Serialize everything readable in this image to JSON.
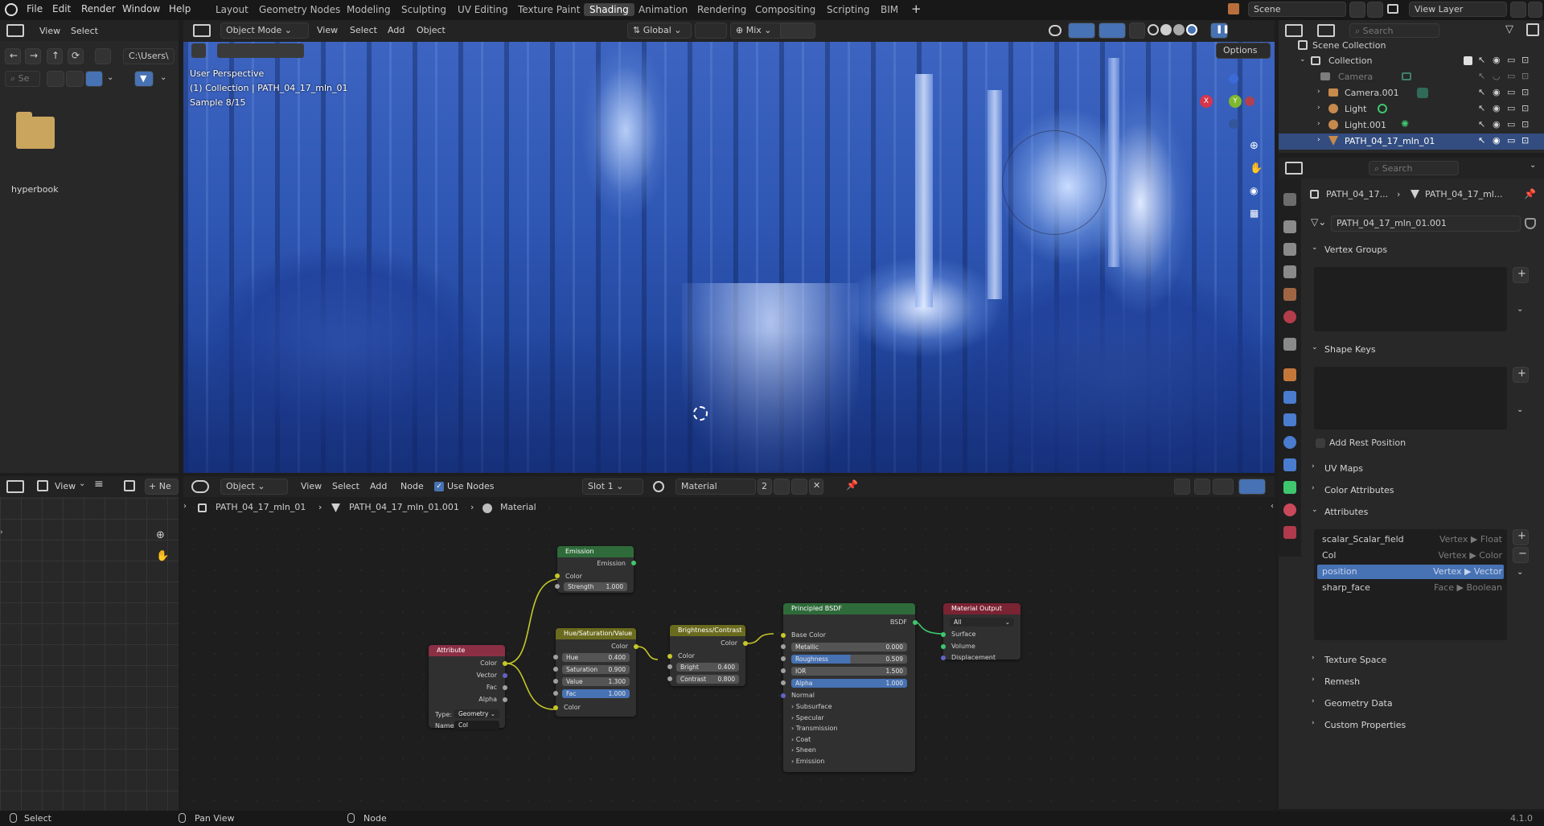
{
  "topbar": {
    "menus": [
      "File",
      "Edit",
      "Render",
      "Window",
      "Help"
    ],
    "workspaces": [
      "Layout",
      "Geometry Nodes",
      "Modeling",
      "Sculpting",
      "UV Editing",
      "Texture Paint",
      "Shading",
      "Animation",
      "Rendering",
      "Compositing",
      "Scripting",
      "BIM"
    ],
    "active_workspace": "Shading",
    "add": "+",
    "scene": "Scene",
    "view_layer": "View Layer"
  },
  "filebrowser": {
    "menus": [
      "View",
      "Select"
    ],
    "path": "C:\\Users\\",
    "search_placeholder": "Se",
    "folder": "hyperbook"
  },
  "viewport": {
    "mode": "Object Mode",
    "menus": [
      "View",
      "Select",
      "Add",
      "Object"
    ],
    "transform": "Global",
    "snap": "Mix",
    "options": "Options",
    "overlay": [
      "User Perspective",
      "(1) Collection | PATH_04_17_mln_01",
      "Sample 8/15"
    ],
    "gizmo": {
      "x": "X",
      "y": "Y",
      "z": "Z"
    }
  },
  "outliner": {
    "search_placeholder": "Search",
    "root": "Scene Collection",
    "items": [
      {
        "name": "Collection"
      },
      {
        "name": "Camera"
      },
      {
        "name": "Camera.001"
      },
      {
        "name": "Light"
      },
      {
        "name": "Light.001"
      },
      {
        "name": "PATH_04_17_mln_01"
      }
    ]
  },
  "properties": {
    "search_placeholder": "Search",
    "crumb1": "PATH_04_17...",
    "crumb2": "PATH_04_17_ml...",
    "mesh_name": "PATH_04_17_mln_01.001",
    "sections": {
      "vertex_groups": "Vertex Groups",
      "shape_keys": "Shape Keys",
      "add_rest": "Add Rest Position",
      "uv_maps": "UV Maps",
      "color_attributes": "Color Attributes",
      "attributes": "Attributes",
      "texture_space": "Texture Space",
      "remesh": "Remesh",
      "geometry_data": "Geometry Data",
      "custom_properties": "Custom Properties"
    },
    "attributes": [
      {
        "name": "scalar_Scalar_field",
        "domain": "Vertex ▶ Float"
      },
      {
        "name": "Col",
        "domain": "Vertex ▶ Color"
      },
      {
        "name": "position",
        "domain": "Vertex ▶ Vector"
      },
      {
        "name": "sharp_face",
        "domain": "Face ▶ Boolean"
      }
    ]
  },
  "left_bottom": {
    "view": "View",
    "new": "Ne"
  },
  "node_editor": {
    "object": "Object",
    "menus": [
      "View",
      "Select",
      "Add",
      "Node"
    ],
    "use_nodes": "Use Nodes",
    "slot": "Slot 1",
    "material": "Material",
    "users": "2",
    "breadcrumb": [
      "PATH_04_17_mln_01",
      "PATH_04_17_mln_01.001",
      "Material"
    ],
    "nodes": {
      "emission": {
        "title": "Emission",
        "out": "Emission",
        "in": "Color",
        "strength_label": "Strength",
        "strength": "1.000"
      },
      "hsv": {
        "title": "Hue/Saturation/Value",
        "out": "Color",
        "hue_l": "Hue",
        "hue": "0.400",
        "sat_l": "Saturation",
        "sat": "0.900",
        "val_l": "Value",
        "val": "1.300",
        "fac_l": "Fac",
        "fac": "1.000",
        "in": "Color"
      },
      "bc": {
        "title": "Brightness/Contrast",
        "out": "Color",
        "in": "Color",
        "bright_l": "Bright",
        "bright": "0.400",
        "contrast_l": "Contrast",
        "contrast": "0.800"
      },
      "bsdf": {
        "title": "Principled BSDF",
        "out": "BSDF",
        "base": "Base Color",
        "metallic_l": "Metallic",
        "metallic": "0.000",
        "rough_l": "Roughness",
        "rough": "0.509",
        "ior_l": "IOR",
        "ior": "1.500",
        "alpha_l": "Alpha",
        "alpha": "1.000",
        "normal": "Normal",
        "panels": [
          "Subsurface",
          "Specular",
          "Transmission",
          "Coat",
          "Sheen",
          "Emission"
        ]
      },
      "output": {
        "title": "Material Output",
        "target": "All",
        "surface": "Surface",
        "volume": "Volume",
        "displacement": "Displacement"
      },
      "attribute": {
        "title": "Attribute",
        "color": "Color",
        "vector": "Vector",
        "fac": "Fac",
        "alpha": "Alpha",
        "type_l": "Type:",
        "type": "Geometry",
        "name_l": "Name:",
        "name": "Col"
      }
    }
  },
  "statusbar": {
    "select": "Select",
    "pan": "Pan View",
    "node": "Node",
    "version": "4.1.0"
  },
  "colors": {
    "accent": "#4772b3",
    "attr_header": "#8b2f45",
    "emission_header": "#2f6b3a",
    "color_header": "#6b6b1f",
    "bsdf_header": "#2f6b3a",
    "output_header": "#7a2333",
    "socket_yellow": "#c7c729",
    "socket_purple": "#6363c7",
    "socket_gray": "#a1a1a1",
    "socket_green": "#3ec76e"
  }
}
